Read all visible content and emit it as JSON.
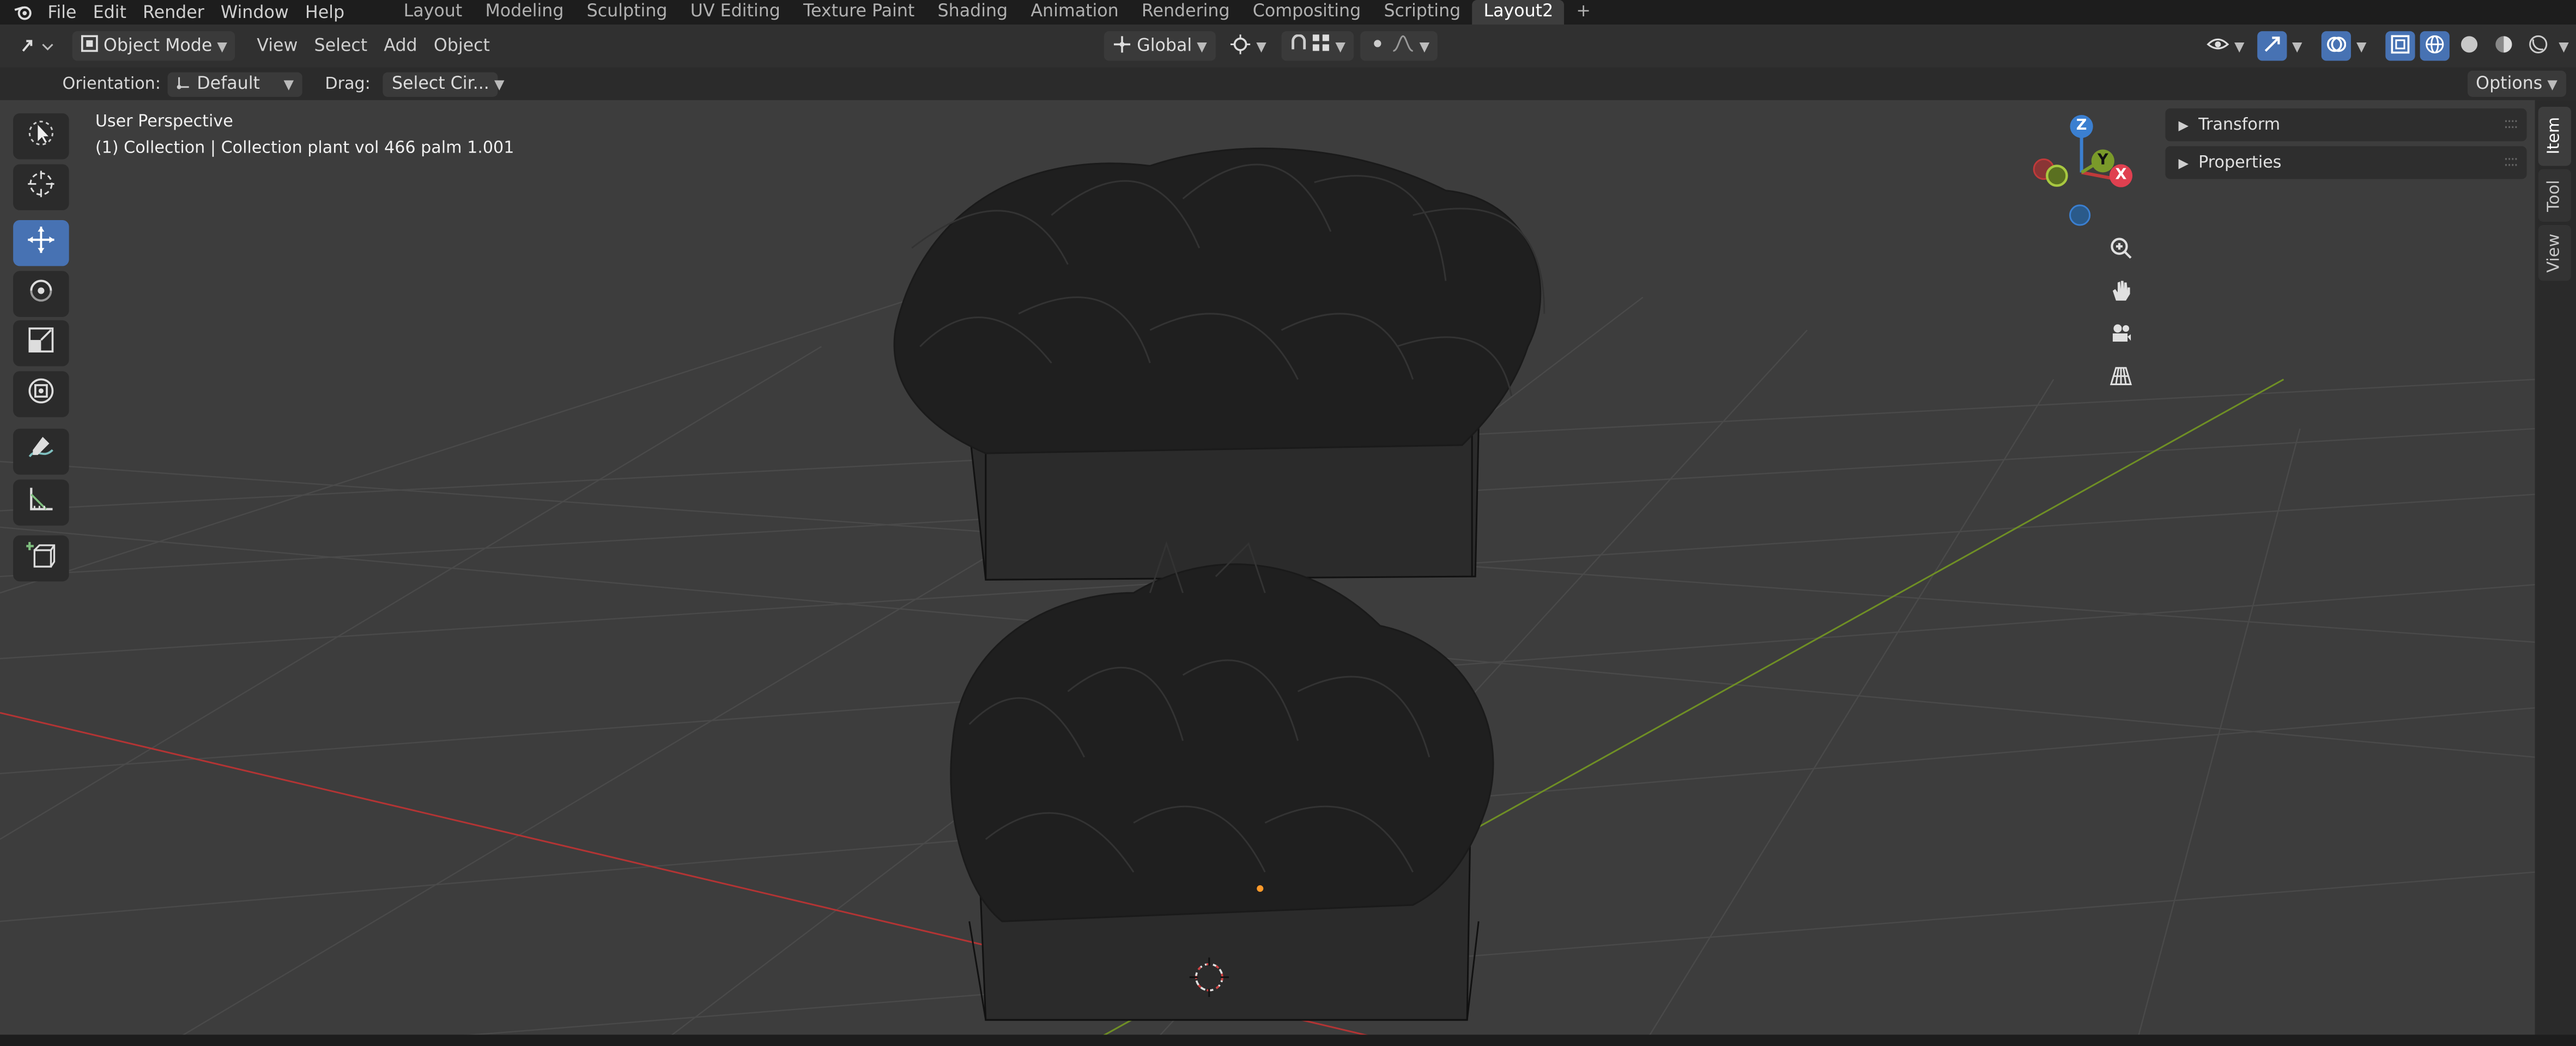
{
  "topbar": {
    "menus": [
      "File",
      "Edit",
      "Render",
      "Window",
      "Help"
    ],
    "workspaces": [
      "Layout",
      "Modeling",
      "Sculpting",
      "UV Editing",
      "Texture Paint",
      "Shading",
      "Animation",
      "Rendering",
      "Compositing",
      "Scripting",
      "Layout2"
    ],
    "active_workspace": "Layout2",
    "add_workspace": "+"
  },
  "header": {
    "mode": "Object Mode",
    "menus": [
      "View",
      "Select",
      "Add",
      "Object"
    ],
    "transform_orientation": "Global",
    "options_label": "Options"
  },
  "tool_settings": {
    "orientation_label": "Orientation:",
    "orientation_value": "Default",
    "drag_label": "Drag:",
    "drag_value": "Select Cir..."
  },
  "viewport": {
    "view_name": "User Perspective",
    "collection_info": "(1) Collection | Collection plant vol 466 palm 1.001"
  },
  "gizmo": {
    "z_label": "Z",
    "y_label": "Y",
    "x_label": "X"
  },
  "n_panel": {
    "sections": [
      "Transform",
      "Properties"
    ],
    "tabs": [
      "Item",
      "Tool",
      "View"
    ],
    "active_tab": "Item"
  },
  "tools": [
    "tweak-icon",
    "cursor-icon",
    "move-icon",
    "rotate-icon",
    "scale-icon",
    "transform-icon",
    "annotate-icon",
    "measure-icon",
    "add-cube-icon"
  ],
  "colors": {
    "accent": "#4772b3",
    "axis_x": "#c03a3a",
    "axis_y": "#7a9a2a",
    "axis_z": "#3b7fd0"
  }
}
